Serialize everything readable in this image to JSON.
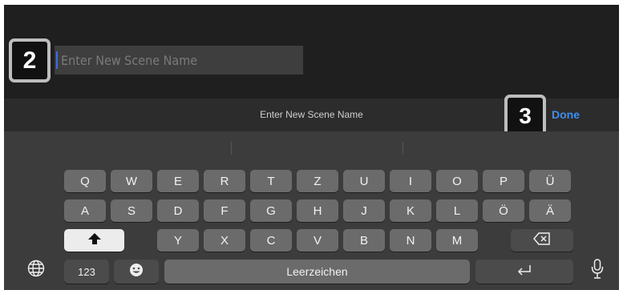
{
  "input": {
    "placeholder": "Enter New Scene Name",
    "value": ""
  },
  "badges": {
    "step_a": "2",
    "step_b": "3"
  },
  "toolbar": {
    "title": "Enter New Scene Name",
    "done_label": "Done"
  },
  "keyboard": {
    "row1": [
      "Q",
      "W",
      "E",
      "R",
      "T",
      "Z",
      "U",
      "I",
      "O",
      "P",
      "Ü"
    ],
    "row2": [
      "A",
      "S",
      "D",
      "F",
      "G",
      "H",
      "J",
      "K",
      "L",
      "Ö",
      "Ä"
    ],
    "row3": [
      "Y",
      "X",
      "C",
      "V",
      "B",
      "N",
      "M"
    ],
    "numbers_label": "123",
    "space_label": "Leerzeichen"
  },
  "icons": {
    "shift": "shift-icon",
    "delete": "delete-icon",
    "globe": "globe-icon",
    "emoji": "emoji-icon",
    "return": "return-icon",
    "microphone": "microphone-icon"
  },
  "colors": {
    "accent": "#3d8ef0",
    "key": "#6b6b6b",
    "key_dark": "#4b4b4b",
    "keyboard_bg": "#3c3c3c"
  }
}
